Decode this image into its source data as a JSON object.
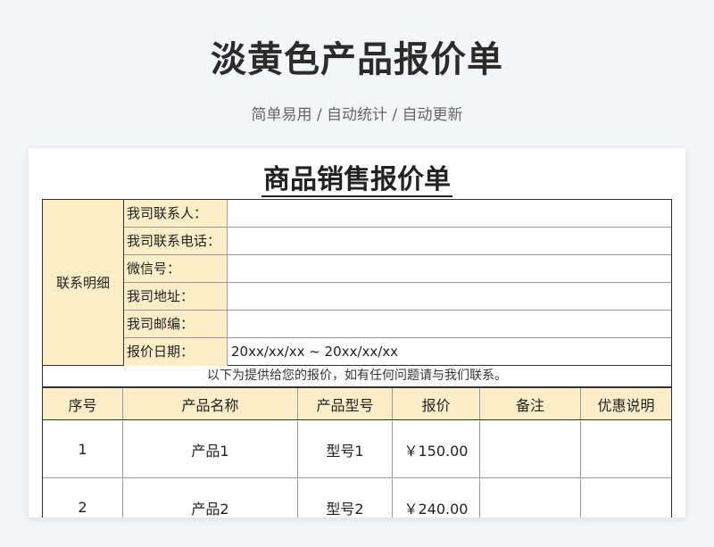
{
  "header": {
    "title": "淡黄色产品报价单",
    "subtitle": "简单易用 / 自动统计 / 自动更新"
  },
  "document": {
    "title": "商品销售报价单",
    "contact_section_label": "联系明细",
    "contact_rows": [
      {
        "label": "我司联系人：",
        "value": ""
      },
      {
        "label": "我司联系电话：",
        "value": ""
      },
      {
        "label": "微信号：",
        "value": ""
      },
      {
        "label": "我司地址：",
        "value": ""
      },
      {
        "label": "我司邮编：",
        "value": ""
      },
      {
        "label": "报价日期：",
        "value": "20xx/xx/xx ~ 20xx/xx/xx"
      }
    ],
    "notice": "以下为提供给您的报价，如有任何问题请与我们联系。",
    "table": {
      "headers": [
        "序号",
        "产品名称",
        "产品型号",
        "报价",
        "备注",
        "优惠说明"
      ],
      "rows": [
        [
          "1",
          "产品1",
          "型号1",
          "￥150.00",
          "",
          ""
        ],
        [
          "2",
          "产品2",
          "型号2",
          "￥240.00",
          "",
          ""
        ]
      ]
    }
  },
  "colors": {
    "accent_fill": "#fdeec7",
    "border": "#333333",
    "background": "#f3f5f8"
  }
}
